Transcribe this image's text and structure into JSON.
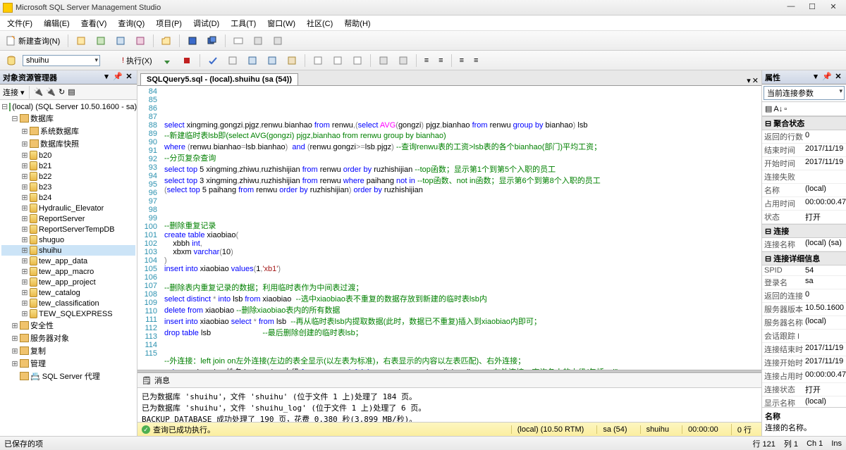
{
  "window": {
    "title": "Microsoft SQL Server Management Studio"
  },
  "menu": [
    "文件(F)",
    "编辑(E)",
    "查看(V)",
    "查询(Q)",
    "项目(P)",
    "调试(D)",
    "工具(T)",
    "窗口(W)",
    "社区(C)",
    "帮助(H)"
  ],
  "toolbar1": {
    "newquery": "新建查询(N)"
  },
  "toolbar2": {
    "dbcombo": "shuihu",
    "execute": "执行(X)"
  },
  "object_explorer": {
    "title": "对象资源管理器",
    "connect": "连接",
    "root": "(local) (SQL Server 10.50.1600 - sa)",
    "folders": {
      "databases": "数据库",
      "sysdb": "系统数据库",
      "snapshot": "数据库快照",
      "security": "安全性",
      "serverobj": "服务器对象",
      "replication": "复制",
      "management": "管理",
      "agent": "SQL Server 代理"
    },
    "dbs": [
      "b20",
      "b21",
      "b22",
      "b23",
      "b24",
      "Hydraulic_Elevator",
      "ReportServer",
      "ReportServerTempDB",
      "shuguo",
      "shuihu",
      "tew_app_data",
      "tew_app_macro",
      "tew_app_project",
      "tew_catalog",
      "tew_classification",
      "TEW_SQLEXPRESS"
    ]
  },
  "editor": {
    "tab_title": "SQLQuery5.sql - (local).shuihu (sa (54))"
  },
  "code_lines": [
    {
      "n": 84,
      "seg": []
    },
    {
      "n": 85,
      "seg": []
    },
    {
      "n": 86,
      "seg": []
    },
    {
      "n": 87,
      "seg": []
    },
    {
      "n": 88,
      "seg": [
        {
          "c": "kw",
          "t": "select"
        },
        {
          "t": " xingming"
        },
        {
          "c": "op",
          "t": ","
        },
        {
          "t": "gongzi"
        },
        {
          "c": "op",
          "t": ","
        },
        {
          "t": "pjgz"
        },
        {
          "c": "op",
          "t": ","
        },
        {
          "t": "renwu"
        },
        {
          "c": "op",
          "t": "."
        },
        {
          "t": "bianhao "
        },
        {
          "c": "kw",
          "t": "from"
        },
        {
          "t": " renwu"
        },
        {
          "c": "op",
          "t": ",("
        },
        {
          "c": "kw",
          "t": "select"
        },
        {
          "t": " "
        },
        {
          "c": "fn",
          "t": "AVG"
        },
        {
          "c": "op",
          "t": "("
        },
        {
          "t": "gongzi"
        },
        {
          "c": "op",
          "t": ")"
        },
        {
          "t": " pjgz"
        },
        {
          "c": "op",
          "t": ","
        },
        {
          "t": "bianhao "
        },
        {
          "c": "kw",
          "t": "from"
        },
        {
          "t": " renwu "
        },
        {
          "c": "kw",
          "t": "group by"
        },
        {
          "t": " bianhao"
        },
        {
          "c": "op",
          "t": ")"
        },
        {
          "t": " lsb"
        }
      ]
    },
    {
      "n": 89,
      "seg": [
        {
          "c": "cm",
          "t": "--新建临时表lsb即(select AVG(gongzi) pjgz,bianhao from renwu group by bianhao)"
        }
      ]
    },
    {
      "n": 90,
      "seg": [
        {
          "c": "kw",
          "t": "where"
        },
        {
          "t": " "
        },
        {
          "c": "op",
          "t": "("
        },
        {
          "t": "renwu"
        },
        {
          "c": "op",
          "t": "."
        },
        {
          "t": "bianhao"
        },
        {
          "c": "op",
          "t": "="
        },
        {
          "t": "lsb"
        },
        {
          "c": "op",
          "t": "."
        },
        {
          "t": "bianhao"
        },
        {
          "c": "op",
          "t": ")"
        },
        {
          "t": " "
        },
        {
          "c": "kw",
          "t": " and "
        },
        {
          "c": "op",
          "t": "("
        },
        {
          "t": "renwu"
        },
        {
          "c": "op",
          "t": "."
        },
        {
          "t": "gongzi"
        },
        {
          "c": "op",
          "t": ">="
        },
        {
          "t": "lsb"
        },
        {
          "c": "op",
          "t": "."
        },
        {
          "t": "pjgz"
        },
        {
          "c": "op",
          "t": ")"
        },
        {
          "t": " "
        },
        {
          "c": "cm",
          "t": "--查询renwu表的工资>lsb表的各个bianhao(部门)平均工资；"
        }
      ]
    },
    {
      "n": 91,
      "seg": [
        {
          "c": "cm",
          "t": "--分页复杂查询"
        }
      ]
    },
    {
      "n": 92,
      "seg": [
        {
          "c": "kw",
          "t": "select top"
        },
        {
          "t": " 5 xingming"
        },
        {
          "c": "op",
          "t": ","
        },
        {
          "t": "zhiwu"
        },
        {
          "c": "op",
          "t": ","
        },
        {
          "t": "ruzhishijian "
        },
        {
          "c": "kw",
          "t": "from"
        },
        {
          "t": " renwu "
        },
        {
          "c": "kw",
          "t": "order by"
        },
        {
          "t": " ruzhishijian "
        },
        {
          "c": "cm",
          "t": "--top函数；显示第1个到第5个入职的员工"
        }
      ]
    },
    {
      "n": 93,
      "seg": [
        {
          "c": "kw",
          "t": "select top"
        },
        {
          "t": " 3 xingming"
        },
        {
          "c": "op",
          "t": ","
        },
        {
          "t": "zhiwu"
        },
        {
          "c": "op",
          "t": ","
        },
        {
          "t": "ruzhishijian "
        },
        {
          "c": "kw",
          "t": "from"
        },
        {
          "t": " renwu "
        },
        {
          "c": "kw",
          "t": "where"
        },
        {
          "t": " paihang "
        },
        {
          "c": "kw",
          "t": "not in"
        },
        {
          "t": " "
        },
        {
          "c": "cm",
          "t": "--top函数、not in函数；显示第6个到第8个入职的员工"
        }
      ]
    },
    {
      "n": 94,
      "seg": [
        {
          "c": "op",
          "t": "("
        },
        {
          "c": "kw",
          "t": "select top"
        },
        {
          "t": " 5 paihang "
        },
        {
          "c": "kw",
          "t": "from"
        },
        {
          "t": " renwu "
        },
        {
          "c": "kw",
          "t": "order by"
        },
        {
          "t": " ruzhishijian"
        },
        {
          "c": "op",
          "t": ")"
        },
        {
          "t": " "
        },
        {
          "c": "kw",
          "t": "order by"
        },
        {
          "t": " ruzhishijian"
        }
      ]
    },
    {
      "n": 95,
      "seg": []
    },
    {
      "n": 96,
      "seg": []
    },
    {
      "n": 97,
      "seg": []
    },
    {
      "n": 98,
      "seg": [
        {
          "c": "cm",
          "t": "--删除重复记录"
        }
      ]
    },
    {
      "n": 99,
      "seg": [
        {
          "c": "kw",
          "t": "create table"
        },
        {
          "t": " xiaobiao"
        },
        {
          "c": "op",
          "t": "("
        }
      ]
    },
    {
      "n": 100,
      "seg": [
        {
          "t": "    xbbh "
        },
        {
          "c": "kw",
          "t": "int"
        },
        {
          "c": "op",
          "t": ","
        }
      ]
    },
    {
      "n": 101,
      "seg": [
        {
          "t": "    xbxm "
        },
        {
          "c": "kw",
          "t": "varchar"
        },
        {
          "c": "op",
          "t": "("
        },
        {
          "t": "10"
        },
        {
          "c": "op",
          "t": ")"
        }
      ]
    },
    {
      "n": 102,
      "seg": [
        {
          "c": "op",
          "t": ")"
        }
      ]
    },
    {
      "n": 103,
      "seg": [
        {
          "c": "kw",
          "t": "insert into"
        },
        {
          "t": " xiaobiao "
        },
        {
          "c": "kw",
          "t": "values"
        },
        {
          "c": "op",
          "t": "("
        },
        {
          "t": "1"
        },
        {
          "c": "op",
          "t": ","
        },
        {
          "c": "str",
          "t": "'xb1'"
        },
        {
          "c": "op",
          "t": ")"
        }
      ]
    },
    {
      "n": 104,
      "seg": []
    },
    {
      "n": 105,
      "seg": [
        {
          "c": "cm",
          "t": "--删除表内重复记录的数据；利用临时表作为中间表过渡；"
        }
      ]
    },
    {
      "n": 106,
      "seg": [
        {
          "c": "kw",
          "t": "select distinct"
        },
        {
          "t": " "
        },
        {
          "c": "op",
          "t": "*"
        },
        {
          "t": " "
        },
        {
          "c": "kw",
          "t": "into"
        },
        {
          "t": " lsb "
        },
        {
          "c": "kw",
          "t": "from"
        },
        {
          "t": " xiaobiao  "
        },
        {
          "c": "cm",
          "t": "--选中xiaobiao表不重复的数据存放到新建的临时表lsb内"
        }
      ]
    },
    {
      "n": 107,
      "seg": [
        {
          "c": "kw",
          "t": "delete from"
        },
        {
          "t": " xiaobiao "
        },
        {
          "c": "cm",
          "t": "--删除xiaobiao表内的所有数据"
        }
      ]
    },
    {
      "n": 108,
      "seg": [
        {
          "c": "kw",
          "t": "insert into"
        },
        {
          "t": " xiaobiao "
        },
        {
          "c": "kw",
          "t": "select"
        },
        {
          "t": " "
        },
        {
          "c": "op",
          "t": "*"
        },
        {
          "t": " "
        },
        {
          "c": "kw",
          "t": "from"
        },
        {
          "t": " lsb  "
        },
        {
          "c": "cm",
          "t": "--再从临时表lsb内提取数据(此时，数据已不重复)插入到xiaobiao内即可；"
        }
      ]
    },
    {
      "n": 109,
      "seg": [
        {
          "c": "kw",
          "t": "drop table"
        },
        {
          "t": " lsb                        "
        },
        {
          "c": "cm",
          "t": "--最后删除创建的临时表lsb；"
        }
      ]
    },
    {
      "n": 110,
      "seg": []
    },
    {
      "n": 111,
      "seg": []
    },
    {
      "n": 112,
      "seg": [
        {
          "c": "cm",
          "t": "--外连接：left join on左外连接(左边的表全显示(以左表为标准)，右表显示的内容以左表匹配)、右外连接；"
        }
      ]
    },
    {
      "n": 113,
      "seg": [
        {
          "c": "kw",
          "t": "select"
        },
        {
          "t": " a"
        },
        {
          "c": "op",
          "t": "."
        },
        {
          "t": "xingming 姓名"
        },
        {
          "c": "op",
          "t": ","
        },
        {
          "t": "b"
        },
        {
          "c": "op",
          "t": "."
        },
        {
          "t": "xingming 上级 "
        },
        {
          "c": "kw",
          "t": "from"
        },
        {
          "t": " renwu a "
        },
        {
          "c": "kw",
          "t": "left join"
        },
        {
          "t": " renwu b "
        },
        {
          "c": "kw",
          "t": "on"
        },
        {
          "t": " a"
        },
        {
          "c": "op",
          "t": "."
        },
        {
          "t": "shangji"
        },
        {
          "c": "op",
          "t": "="
        },
        {
          "t": "b"
        },
        {
          "c": "op",
          "t": "."
        },
        {
          "t": "paihang "
        },
        {
          "c": "cm",
          "t": "--左外连接；查询各人的上级(包括null)"
        }
      ]
    },
    {
      "n": 114,
      "seg": []
    },
    {
      "n": 115,
      "seg": []
    }
  ],
  "messages": {
    "tab": "消息",
    "body": "已为数据库 'shuihu'，文件 'shuihu' (位于文件 1 上)处理了 184 页。\n已为数据库 'shuihu'，文件 'shuihu_log' (位于文件 1 上)处理了 6 页。\nBACKUP DATABASE 成功处理了 190 页，花费 0.380 秒(3.899 MB/秒)。"
  },
  "querystatus": {
    "ok": "查询已成功执行。",
    "server": "(local) (10.50 RTM)",
    "user": "sa (54)",
    "db": "shuihu",
    "time": "00:00:00",
    "rows": "0 行"
  },
  "statusbar": {
    "saved": "已保存的项",
    "line": "行 121",
    "col": "列 1",
    "ch": "Ch 1",
    "ins": "Ins"
  },
  "properties": {
    "title": "属性",
    "selector": "当前连接参数",
    "cats": {
      "agg": "聚合状态",
      "conn": "连接",
      "conndet": "连接详细信息"
    },
    "rows": [
      {
        "cat": "agg",
        "k": "返回的行数",
        "v": "0"
      },
      {
        "cat": "agg",
        "k": "结束时间",
        "v": "2017/11/19"
      },
      {
        "cat": "agg",
        "k": "开始时间",
        "v": "2017/11/19"
      },
      {
        "cat": "agg",
        "k": "连接失败",
        "v": ""
      },
      {
        "cat": "agg",
        "k": "名称",
        "v": "(local)"
      },
      {
        "cat": "agg",
        "k": "占用时间",
        "v": "00:00:00.477"
      },
      {
        "cat": "agg",
        "k": "状态",
        "v": "打开"
      },
      {
        "cat": "conn",
        "k": "连接名称",
        "v": "(local) (sa)"
      },
      {
        "cat": "conndet",
        "k": "SPID",
        "v": "54"
      },
      {
        "cat": "conndet",
        "k": "登录名",
        "v": "sa"
      },
      {
        "cat": "conndet",
        "k": "返回的连接",
        "v": "0"
      },
      {
        "cat": "conndet",
        "k": "服务器版本",
        "v": "10.50.1600"
      },
      {
        "cat": "conndet",
        "k": "服务器名称",
        "v": "(local)"
      },
      {
        "cat": "conndet",
        "k": "会话跟踪 I",
        "v": ""
      },
      {
        "cat": "conndet",
        "k": "连接结束时",
        "v": "2017/11/19"
      },
      {
        "cat": "conndet",
        "k": "连接开始时",
        "v": "2017/11/19"
      },
      {
        "cat": "conndet",
        "k": "连接占用时",
        "v": "00:00:00.477"
      },
      {
        "cat": "conndet",
        "k": "连接状态",
        "v": "打开"
      },
      {
        "cat": "conndet",
        "k": "显示名称",
        "v": "(local)"
      }
    ],
    "desc_title": "名称",
    "desc_body": "连接的名称。"
  }
}
